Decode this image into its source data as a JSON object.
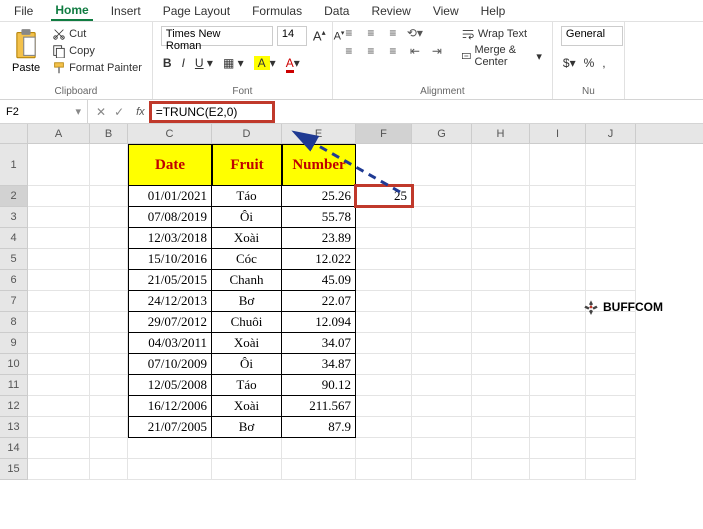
{
  "tabs": [
    "File",
    "Home",
    "Insert",
    "Page Layout",
    "Formulas",
    "Data",
    "Review",
    "View",
    "Help"
  ],
  "activeTab": 1,
  "clipboard": {
    "paste": "Paste",
    "cut": "Cut",
    "copy": "Copy",
    "painter": "Format Painter",
    "label": "Clipboard"
  },
  "font": {
    "name": "Times New Roman",
    "size": "14",
    "label": "Font"
  },
  "alignment": {
    "wrap": "Wrap Text",
    "merge": "Merge & Center",
    "label": "Alignment"
  },
  "number": {
    "format": "General",
    "label": "Nu"
  },
  "nameBox": "F2",
  "formula": "=TRUNC(E2,0)",
  "cols": [
    "A",
    "B",
    "C",
    "D",
    "E",
    "F",
    "G",
    "H",
    "I",
    "J"
  ],
  "headers": {
    "c": "Date",
    "d": "Fruit",
    "e": "Number"
  },
  "result": "25",
  "rows": [
    {
      "n": "1"
    },
    {
      "n": "2",
      "c": "01/01/2021",
      "d": "Táo",
      "e": "25.26"
    },
    {
      "n": "3",
      "c": "07/08/2019",
      "d": "Ôi",
      "e": "55.78"
    },
    {
      "n": "4",
      "c": "12/03/2018",
      "d": "Xoài",
      "e": "23.89"
    },
    {
      "n": "5",
      "c": "15/10/2016",
      "d": "Cóc",
      "e": "12.022"
    },
    {
      "n": "6",
      "c": "21/05/2015",
      "d": "Chanh",
      "e": "45.09"
    },
    {
      "n": "7",
      "c": "24/12/2013",
      "d": "Bơ",
      "e": "22.07"
    },
    {
      "n": "8",
      "c": "29/07/2012",
      "d": "Chuôi",
      "e": "12.094"
    },
    {
      "n": "9",
      "c": "04/03/2011",
      "d": "Xoài",
      "e": "34.07"
    },
    {
      "n": "10",
      "c": "07/10/2009",
      "d": "Ôi",
      "e": "34.87"
    },
    {
      "n": "11",
      "c": "12/05/2008",
      "d": "Táo",
      "e": "90.12"
    },
    {
      "n": "12",
      "c": "16/12/2006",
      "d": "Xoài",
      "e": "211.567"
    },
    {
      "n": "13",
      "c": "21/07/2005",
      "d": "Bơ",
      "e": "87.9"
    },
    {
      "n": "14"
    },
    {
      "n": "15"
    }
  ],
  "watermark": "BUFFCOM"
}
